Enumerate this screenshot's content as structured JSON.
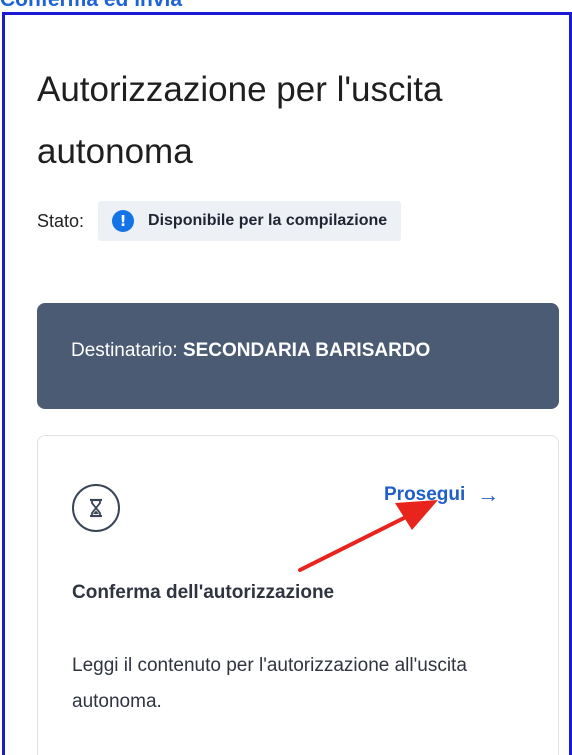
{
  "top_caption": "Conferma ed invia",
  "page": {
    "title": "Autorizzazione per l'uscita autonoma",
    "status_label": "Stato:",
    "status_value": "Disponibile per la compilazione",
    "status_icon": "info-icon"
  },
  "recipient": {
    "label": "Destinatario:",
    "name": "SECONDARIA BARISARDO"
  },
  "card": {
    "icon": "hourglass-icon",
    "proceed_label": "Prosegui",
    "proceed_arrow": "→",
    "title": "Conferma dell'autorizzazione",
    "description": "Leggi il contenuto per l'autorizzazione all'uscita autonoma."
  },
  "colors": {
    "frame_border": "#1a1ad6",
    "recipient_bg": "#4b5b73",
    "link": "#1f5fc7",
    "info_badge": "#1473e6",
    "annotation_arrow": "#e8241c"
  }
}
